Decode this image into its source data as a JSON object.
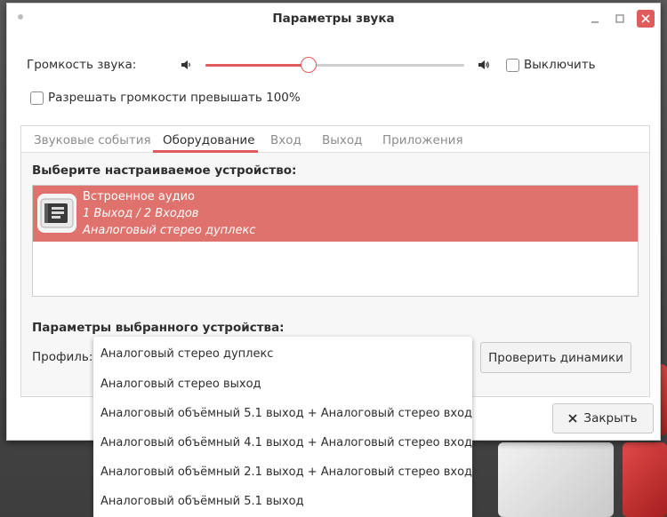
{
  "window": {
    "title": "Параметры звука"
  },
  "volume": {
    "label": "Громкость звука:",
    "level_fraction": 0.4,
    "mute_label": "Выключить",
    "mute_checked": false
  },
  "overamplify": {
    "label": "Разрешать громкости превышать 100%",
    "checked": false
  },
  "tabs": [
    {
      "label": "Звуковые события",
      "active": false
    },
    {
      "label": "Оборудование",
      "active": true
    },
    {
      "label": "Вход",
      "active": false
    },
    {
      "label": "Выход",
      "active": false
    },
    {
      "label": "Приложения",
      "active": false
    }
  ],
  "hardware": {
    "select_device_title": "Выберите настраиваемое устройство:",
    "device": {
      "name": "Встроенное аудио",
      "ports": "1 Выход / 2 Входов",
      "profile": "Аналоговый стерео дуплекс"
    },
    "settings_title": "Параметры выбранного устройства:",
    "profile_label": "Профиль:",
    "test_speakers_label": "Проверить динамики"
  },
  "profile_options": [
    "Аналоговый стерео дуплекс",
    "Аналоговый стерео выход",
    "Аналоговый объёмный 5.1 выход + Аналоговый стерео вход",
    "Аналоговый объёмный 4.1 выход + Аналоговый стерео вход",
    "Аналоговый объёмный 2.1 выход + Аналоговый стерео вход",
    "Аналоговый объёмный 5.1 выход"
  ],
  "footer": {
    "close_label": "Закрыть"
  },
  "colors": {
    "accent": "#e05b5b",
    "selection": "#df726c"
  }
}
